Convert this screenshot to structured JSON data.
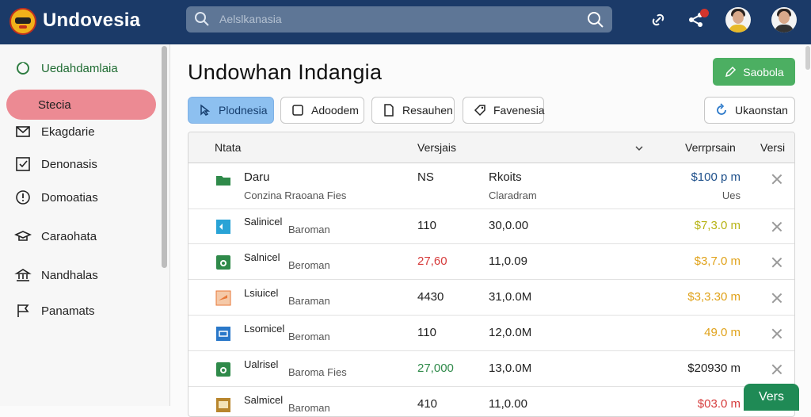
{
  "app": {
    "brand": "Undovesia",
    "search_placeholder": "Aelslkanasia"
  },
  "sidebar": {
    "items": [
      {
        "label": "Uedahdamlaia",
        "icon": "circle-icon",
        "active": false
      },
      {
        "label": "Stecia",
        "icon": "none",
        "active": true
      },
      {
        "label": "Ekagdarie",
        "icon": "mail-icon",
        "active": false
      },
      {
        "label": "Denonasis",
        "icon": "check-square-icon",
        "active": false
      },
      {
        "label": "Domoatias",
        "icon": "alert-circle-icon",
        "active": false
      },
      {
        "label": "Caraohata",
        "icon": "graduation-cap-icon",
        "active": false
      },
      {
        "label": "Nandhalas",
        "icon": "bank-icon",
        "active": false
      },
      {
        "label": "Panamats",
        "icon": "flag-icon",
        "active": false
      }
    ]
  },
  "main": {
    "title": "Undowhan  Indangia",
    "primary_button": "Saobola",
    "filters": [
      {
        "label": "Plodnesia",
        "active": true
      },
      {
        "label": "Adoodem",
        "active": false
      },
      {
        "label": "Resauhen",
        "active": false
      },
      {
        "label": "Favenesia",
        "active": false
      }
    ],
    "right_filter": "Ukaonstan",
    "table": {
      "headers": [
        "Ntata",
        "Versjais",
        "Verrprsain",
        "Versi"
      ],
      "rows": [
        {
          "name": "Daru",
          "sub": "Conzina Rraoana Fies",
          "col2": "NS",
          "col3": "Rkoits",
          "col3_sub": "Claradram",
          "amount": "$100 p m",
          "amount_sub": "Ues",
          "amount_color": "#1d4f8a",
          "col2_color": "#222222",
          "icon": "folder-icon",
          "icon_color": "#2f8a4a"
        },
        {
          "name": "Salinicel",
          "sub": "Baroman",
          "col2": "110",
          "col3": "30,0.00",
          "col3_sub": "",
          "amount": "$7,3.0 m",
          "amount_sub": "",
          "amount_color": "#b7b315",
          "col2_color": "#222222",
          "icon": "image-icon",
          "icon_color": "#29a3d6"
        },
        {
          "name": "Salnicel",
          "sub": "Beroman",
          "col2": "27,60",
          "col3": "11,0.09",
          "col3_sub": "",
          "amount": "$3,7.0 m",
          "amount_sub": "",
          "amount_color": "#e0a21a",
          "col2_color": "#d63b3b",
          "icon": "spreadsheet-icon",
          "icon_color": "#2f8a4a"
        },
        {
          "name": "Lsiuicel",
          "sub": "Baraman",
          "col2": "4430",
          "col3": "31,0.0M",
          "col3_sub": "",
          "amount": "$3,3.30 m",
          "amount_sub": "",
          "amount_color": "#e0a21a",
          "col2_color": "#222222",
          "icon": "presentation-icon",
          "icon_color": "#e8793a"
        },
        {
          "name": "Lsomicel",
          "sub": "Beroman",
          "col2": "110",
          "col3": "12,0.0M",
          "col3_sub": "",
          "amount": "49.0 m",
          "amount_sub": "",
          "amount_color": "#e0a21a",
          "col2_color": "#222222",
          "icon": "document-icon",
          "icon_color": "#2a78c9"
        },
        {
          "name": "Ualrisel",
          "sub": "Baroma Fies",
          "col2": "27,000",
          "col3": "13,0.0M",
          "col3_sub": "",
          "amount": "$20930 m",
          "amount_sub": "",
          "amount_color": "#222222",
          "col2_color": "#2f8a4a",
          "icon": "spreadsheet-icon",
          "icon_color": "#2f8a4a"
        },
        {
          "name": "Salmicel",
          "sub": "Baroman",
          "col2": "410",
          "col3": "11,0.00",
          "col3_sub": "",
          "amount": "$03.0 m",
          "amount_sub": "",
          "amount_color": "#d63b3b",
          "col2_color": "#222222",
          "icon": "archive-icon",
          "icon_color": "#b8862d"
        }
      ]
    },
    "floating_button": "Vers"
  }
}
